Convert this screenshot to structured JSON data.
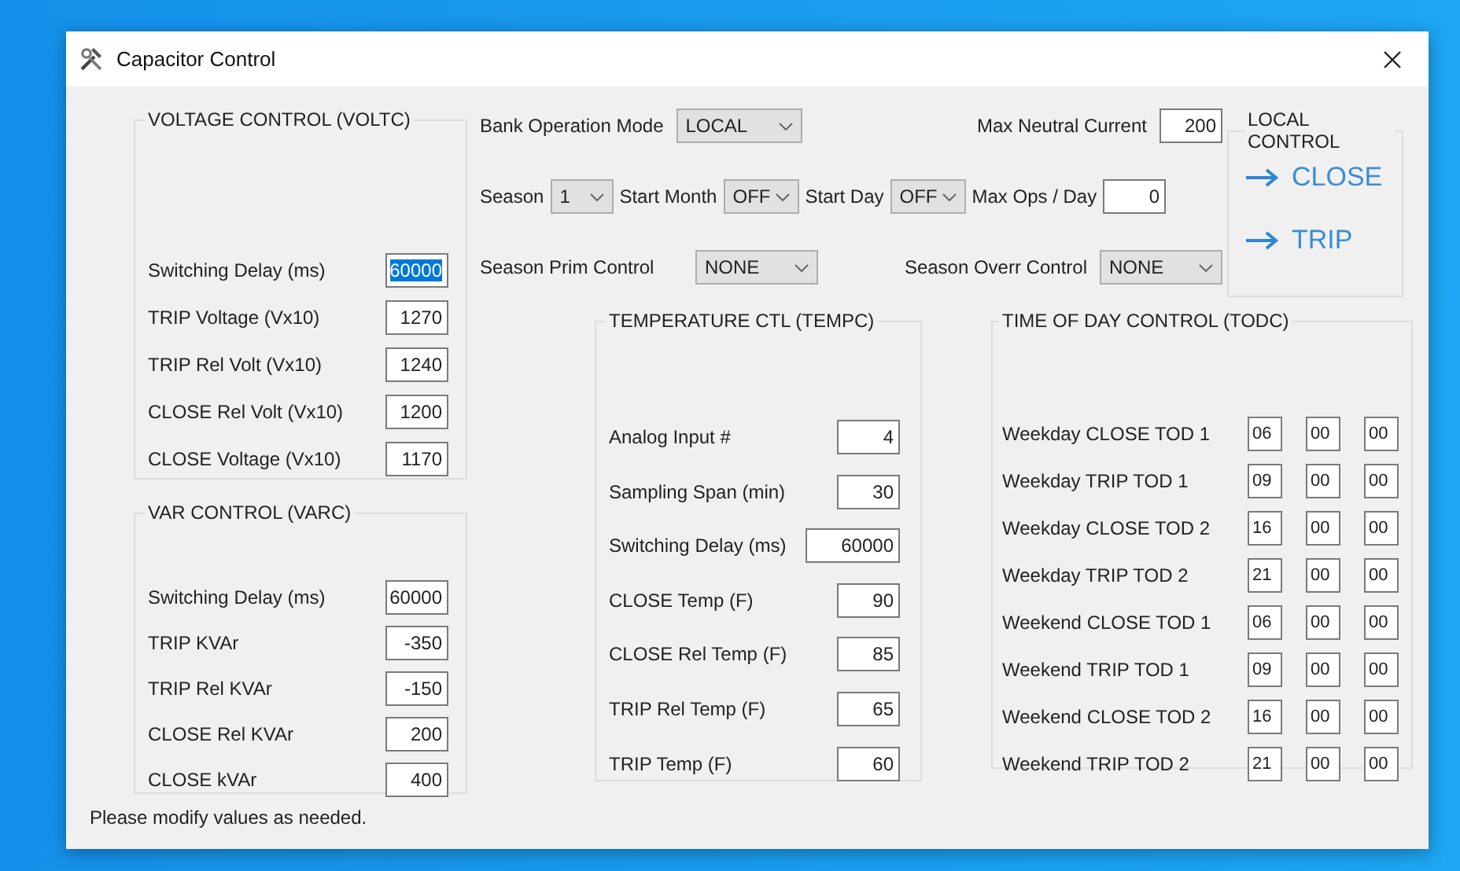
{
  "window": {
    "title": "Capacitor Control"
  },
  "voltage_control": {
    "title": "VOLTAGE CONTROL (VOLTC)",
    "fields": [
      {
        "label": "Switching Delay (ms)",
        "value": "60000",
        "highlighted": true
      },
      {
        "label": "TRIP Voltage (Vx10)",
        "value": "1270",
        "highlighted": false
      },
      {
        "label": "TRIP Rel Volt (Vx10)",
        "value": "1240",
        "highlighted": false
      },
      {
        "label": "CLOSE Rel Volt (Vx10)",
        "value": "1200",
        "highlighted": false
      },
      {
        "label": "CLOSE Voltage (Vx10)",
        "value": "1170",
        "highlighted": false
      }
    ]
  },
  "var_control": {
    "title": "VAR CONTROL (VARC)",
    "fields": [
      {
        "label": "Switching Delay (ms)",
        "value": "60000",
        "highlighted": false
      },
      {
        "label": "TRIP KVAr",
        "value": "-350",
        "highlighted": false
      },
      {
        "label": "TRIP Rel KVAr",
        "value": "-150",
        "highlighted": false
      },
      {
        "label": "CLOSE Rel KVAr",
        "value": "200",
        "highlighted": false
      },
      {
        "label": "CLOSE kVAr",
        "value": "400",
        "highlighted": false
      }
    ]
  },
  "bank_operation_mode": {
    "label": "Bank Operation Mode",
    "value": "LOCAL"
  },
  "max_neutral_current": {
    "label": "Max Neutral Current",
    "value": "200"
  },
  "season": {
    "label": "Season",
    "value": "1"
  },
  "start_month": {
    "label": "Start Month",
    "value": "OFF"
  },
  "start_day": {
    "label": "Start Day",
    "value": "OFF"
  },
  "max_ops_per_day": {
    "label": "Max Ops / Day",
    "value": "0"
  },
  "season_prim_control": {
    "label": "Season Prim Control",
    "value": "NONE"
  },
  "season_overr_control": {
    "label": "Season Overr Control",
    "value": "NONE"
  },
  "local_control": {
    "title": "LOCAL CONTROL",
    "buttons": [
      "CLOSE",
      "TRIP"
    ]
  },
  "temperature_control": {
    "title": "TEMPERATURE CTL (TEMPC)",
    "fields": [
      {
        "label": "Analog Input #",
        "value": "4",
        "highlighted": false
      },
      {
        "label": "Sampling Span (min)",
        "value": "30",
        "highlighted": false
      },
      {
        "label": "Switching Delay (ms)",
        "value": "60000",
        "highlighted": false
      },
      {
        "label": "CLOSE Temp (F)",
        "value": "90",
        "highlighted": false
      },
      {
        "label": "CLOSE Rel Temp (F)",
        "value": "85",
        "highlighted": false
      },
      {
        "label": "TRIP Rel Temp (F)",
        "value": "65",
        "highlighted": false
      },
      {
        "label": "TRIP Temp (F)",
        "value": "60",
        "highlighted": false
      }
    ]
  },
  "time_of_day_control": {
    "title": "TIME OF DAY CONTROL (TODC)",
    "rows": [
      {
        "label": "Weekday CLOSE TOD 1",
        "values": [
          "06",
          "00",
          "00"
        ]
      },
      {
        "label": "Weekday TRIP TOD 1",
        "values": [
          "09",
          "00",
          "00"
        ]
      },
      {
        "label": "Weekday CLOSE TOD 2",
        "values": [
          "16",
          "00",
          "00"
        ]
      },
      {
        "label": "Weekday TRIP TOD 2",
        "values": [
          "21",
          "00",
          "00"
        ]
      },
      {
        "label": "Weekend CLOSE TOD 1",
        "values": [
          "06",
          "00",
          "00"
        ]
      },
      {
        "label": "Weekend TRIP TOD 1",
        "values": [
          "09",
          "00",
          "00"
        ]
      },
      {
        "label": "Weekend CLOSE TOD 2",
        "values": [
          "16",
          "00",
          "00"
        ]
      },
      {
        "label": "Weekend TRIP TOD 2",
        "values": [
          "21",
          "00",
          "00"
        ]
      }
    ]
  },
  "status_text": "Please modify values as needed."
}
